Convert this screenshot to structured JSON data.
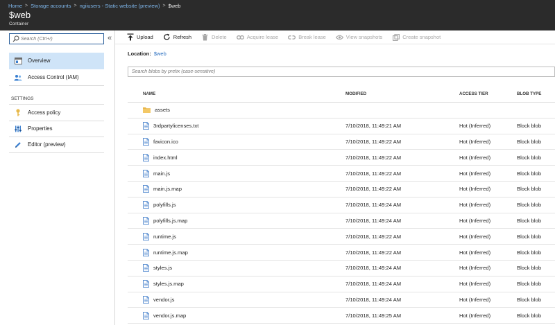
{
  "breadcrumb": {
    "items": [
      "Home",
      "Storage accounts",
      "ngiiusers - Static website (preview)"
    ],
    "current": "$web"
  },
  "header": {
    "title": "$web",
    "subtitle": "Container"
  },
  "sidebar": {
    "search_placeholder": "Search (Ctrl+/)",
    "collapse_glyph": "«",
    "items": [
      {
        "label": "Overview",
        "icon": "overview-icon",
        "active": true
      },
      {
        "label": "Access Control (IAM)",
        "icon": "iam-icon"
      }
    ],
    "section_label": "SETTINGS",
    "settings_items": [
      {
        "label": "Access policy",
        "icon": "key-icon"
      },
      {
        "label": "Properties",
        "icon": "properties-icon"
      },
      {
        "label": "Editor (preview)",
        "icon": "pencil-icon"
      }
    ]
  },
  "toolbar": {
    "upload": "Upload",
    "refresh": "Refresh",
    "delete": "Delete",
    "acquire_lease": "Acquire lease",
    "break_lease": "Break lease",
    "view_snapshots": "View snapshots",
    "create_snapshot": "Create snapshot"
  },
  "location": {
    "label": "Location:",
    "value": "$web"
  },
  "blob_search": {
    "placeholder": "Search blobs by prefix (case-sensitive)"
  },
  "table": {
    "headers": {
      "name": "NAME",
      "modified": "MODIFIED",
      "access_tier": "ACCESS TIER",
      "blob_type": "BLOB TYPE"
    },
    "rows": [
      {
        "name": "assets",
        "kind": "folder",
        "modified": "",
        "tier": "",
        "type": ""
      },
      {
        "name": "3rdpartylicenses.txt",
        "kind": "file",
        "modified": "7/10/2018, 11:49:21 AM",
        "tier": "Hot (Inferred)",
        "type": "Block blob"
      },
      {
        "name": "favicon.ico",
        "kind": "file",
        "modified": "7/10/2018, 11:49:22 AM",
        "tier": "Hot (Inferred)",
        "type": "Block blob"
      },
      {
        "name": "index.html",
        "kind": "file",
        "modified": "7/10/2018, 11:49:22 AM",
        "tier": "Hot (Inferred)",
        "type": "Block blob"
      },
      {
        "name": "main.js",
        "kind": "file",
        "modified": "7/10/2018, 11:49:22 AM",
        "tier": "Hot (Inferred)",
        "type": "Block blob"
      },
      {
        "name": "main.js.map",
        "kind": "file",
        "modified": "7/10/2018, 11:49:22 AM",
        "tier": "Hot (Inferred)",
        "type": "Block blob"
      },
      {
        "name": "polyfills.js",
        "kind": "file",
        "modified": "7/10/2018, 11:49:24 AM",
        "tier": "Hot (Inferred)",
        "type": "Block blob"
      },
      {
        "name": "polyfills.js.map",
        "kind": "file",
        "modified": "7/10/2018, 11:49:24 AM",
        "tier": "Hot (Inferred)",
        "type": "Block blob"
      },
      {
        "name": "runtime.js",
        "kind": "file",
        "modified": "7/10/2018, 11:49:22 AM",
        "tier": "Hot (Inferred)",
        "type": "Block blob"
      },
      {
        "name": "runtime.js.map",
        "kind": "file",
        "modified": "7/10/2018, 11:49:22 AM",
        "tier": "Hot (Inferred)",
        "type": "Block blob"
      },
      {
        "name": "styles.js",
        "kind": "file",
        "modified": "7/10/2018, 11:49:24 AM",
        "tier": "Hot (Inferred)",
        "type": "Block blob"
      },
      {
        "name": "styles.js.map",
        "kind": "file",
        "modified": "7/10/2018, 11:49:24 AM",
        "tier": "Hot (Inferred)",
        "type": "Block blob"
      },
      {
        "name": "vendor.js",
        "kind": "file",
        "modified": "7/10/2018, 11:49:24 AM",
        "tier": "Hot (Inferred)",
        "type": "Block blob"
      },
      {
        "name": "vendor.js.map",
        "kind": "file",
        "modified": "7/10/2018, 11:49:25 AM",
        "tier": "Hot (Inferred)",
        "type": "Block blob"
      }
    ]
  },
  "colors": {
    "header_bg": "#2b2b2b",
    "link": "#2a6fc0",
    "active_nav": "#cfe4f8",
    "file_icon": "#5b8fd1",
    "folder_icon": "#e8b64a"
  }
}
